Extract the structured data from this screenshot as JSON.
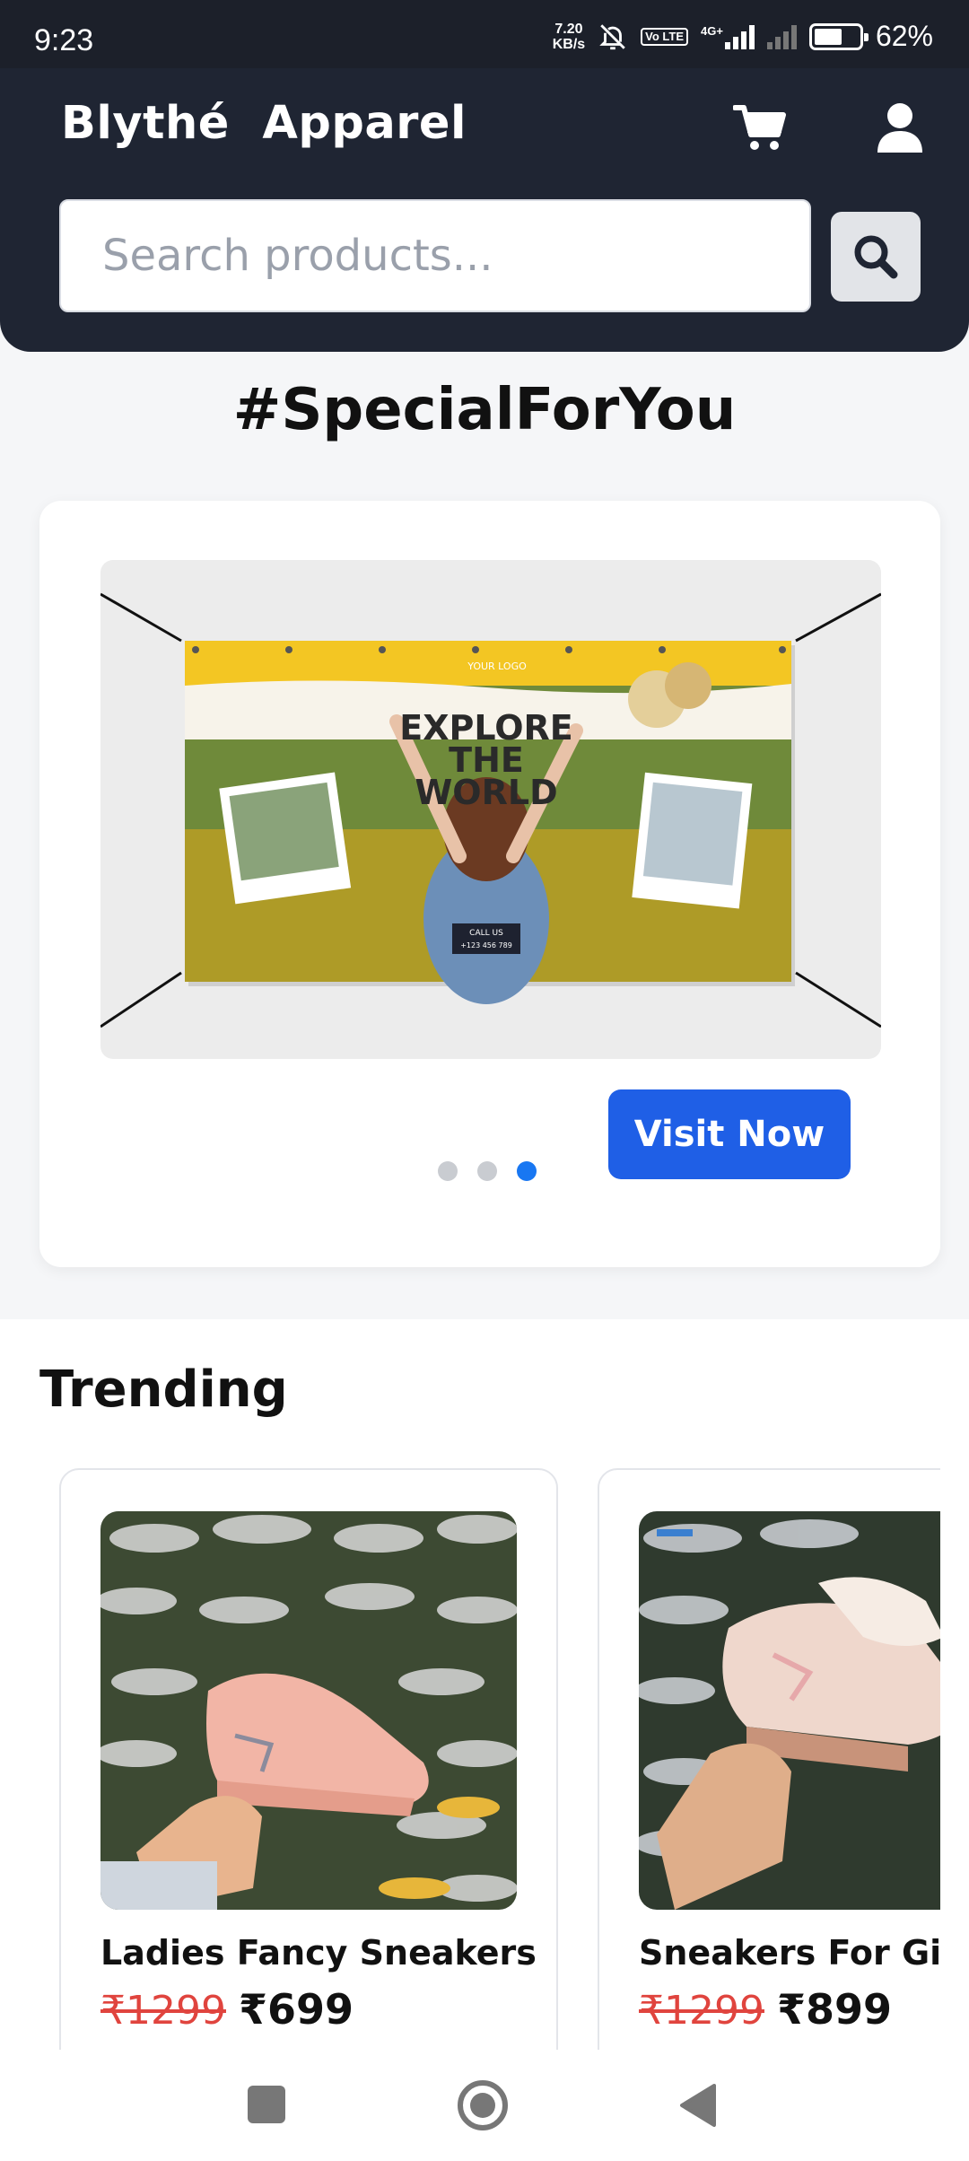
{
  "status_bar": {
    "time": "9:23",
    "speed_value": "7.20",
    "speed_unit": "KB/s",
    "volte_badge": "Vo LTE",
    "network": "4G+",
    "battery": "62%",
    "battery_level": 0.62
  },
  "header": {
    "brand": "Blythé  Apparel",
    "cart_icon": "cart-icon",
    "user_icon": "user-icon",
    "search_placeholder": "Search products...",
    "search_icon": "search-icon"
  },
  "special": {
    "title": "#SpecialForYou",
    "banner": {
      "logo_text": "YOUR LOGO",
      "headline_1": "EXPLORE",
      "headline_2": "THE",
      "headline_3": "WORLD",
      "call_label": "CALL US",
      "call_number": "+123 456 789"
    },
    "dots_count": 3,
    "active_dot": 3,
    "visit_label": "Visit Now"
  },
  "trending": {
    "title": "Trending",
    "products": [
      {
        "name": "Ladies Fancy Sneakers",
        "old_price": "₹1299",
        "price": "₹699"
      },
      {
        "name": "Sneakers For Girls",
        "old_price": "₹1299",
        "price": "₹899"
      }
    ]
  },
  "nav": {
    "recent_icon": "square-icon",
    "home_icon": "circle-icon",
    "back_icon": "triangle-back-icon"
  },
  "colors": {
    "header_bg": "#1f2533",
    "accent": "#1f5fe6",
    "active_dot": "#1877f2",
    "old_price": "#e0443e"
  }
}
